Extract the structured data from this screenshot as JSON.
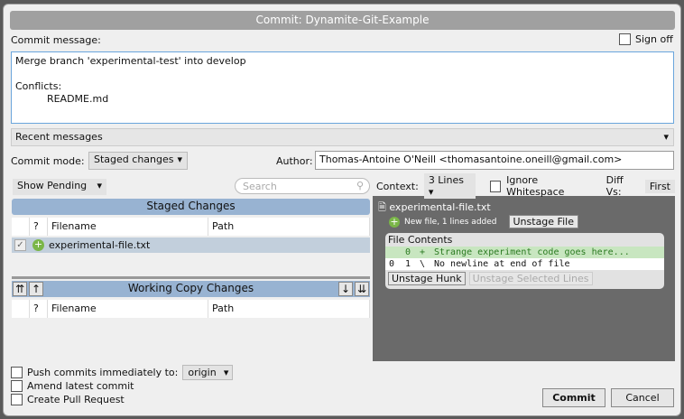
{
  "dialog": {
    "title": "Commit: Dynamite-Git-Example"
  },
  "commit_message": {
    "label": "Commit message:",
    "value": "Merge branch 'experimental-test' into develop\n\nConflicts:\n          README.md",
    "sign_off": "Sign off"
  },
  "recent_messages": "Recent messages",
  "commit_mode": {
    "label": "Commit mode:",
    "value": "Staged changes"
  },
  "author": {
    "label": "Author:",
    "value": "Thomas-Antoine O'Neill <thomasantoine.oneill@gmail.com>"
  },
  "filter": {
    "show": "Show Pending",
    "search_placeholder": "Search"
  },
  "staged": {
    "title": "Staged Changes",
    "columns": [
      "?",
      "Filename",
      "Path"
    ],
    "rows": [
      {
        "filename": "experimental-file.txt",
        "path": ""
      }
    ]
  },
  "working": {
    "title": "Working Copy Changes",
    "columns": [
      "?",
      "Filename",
      "Path"
    ]
  },
  "diff": {
    "context_label": "Context:",
    "context_value": "3 Lines",
    "ignore_ws": "Ignore Whitespace",
    "diff_vs_label": "Diff Vs:",
    "diff_vs_value": "First",
    "file": "experimental-file.txt",
    "status": "New file, 1 lines added",
    "unstage_file": "Unstage File",
    "hunk_title": "File Contents",
    "lines": [
      {
        "old": "",
        "new": "0",
        "sign": "+",
        "text": "Strange experiment code goes here..."
      },
      {
        "old": "0",
        "new": "1",
        "sign": "\\",
        "text": " No newline at end of file"
      }
    ],
    "unstage_hunk": "Unstage Hunk",
    "unstage_lines": "Unstage Selected Lines"
  },
  "options": {
    "push": "Push commits immediately to:",
    "remote": "origin",
    "amend": "Amend latest commit",
    "pull_request": "Create Pull Request"
  },
  "buttons": {
    "commit": "Commit",
    "cancel": "Cancel"
  }
}
